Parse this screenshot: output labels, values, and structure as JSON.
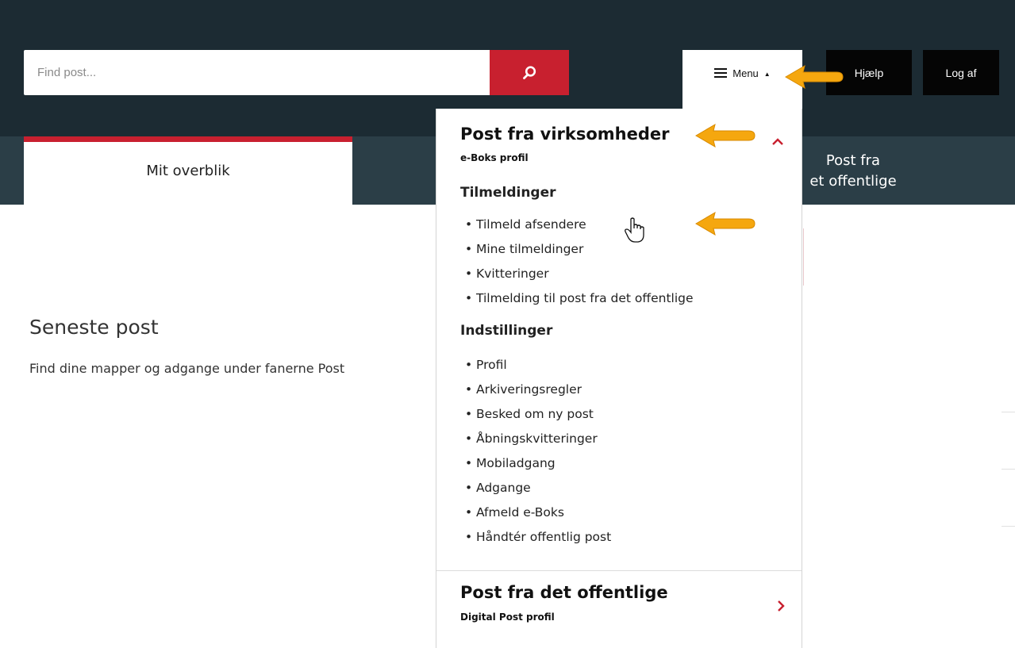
{
  "header": {
    "search": {
      "placeholder": "Find post...",
      "value": ""
    },
    "search_button_icon": "search-icon",
    "menu": {
      "label": "Menu",
      "caret": "▲",
      "icon": "hamburger-icon"
    },
    "help_label": "Hjælp",
    "logout_label": "Log af"
  },
  "tabs": {
    "active_label": "Mit overblik",
    "second_line1": "Post fra",
    "second_line2": "et offentlige"
  },
  "main": {
    "title": "Seneste post",
    "description": "Find dine mapper og adgange under fanerne Post"
  },
  "menu_dropdown": {
    "group1": {
      "title": "Post fra virksomheder",
      "subtitle": "e-Boks profil",
      "sections": [
        {
          "heading": "Tilmeldinger",
          "items": [
            "Tilmeld afsendere",
            "Mine tilmeldinger",
            "Kvitteringer",
            "Tilmelding til post fra det offentlige"
          ]
        },
        {
          "heading": "Indstillinger",
          "items": [
            "Profil",
            "Arkiveringsregler",
            "Besked om ny post",
            "Åbningskvitteringer",
            "Mobiladgang",
            "Adgange",
            "Afmeld e-Boks",
            "Håndtér offentlig post"
          ]
        }
      ]
    },
    "group2": {
      "title": "Post fra det offentlige",
      "subtitle": "Digital Post profil"
    },
    "bullet": "•"
  },
  "colors": {
    "header_bg": "#1c2b33",
    "tabbar_bg": "#2b3e47",
    "accent_red": "#c8202f",
    "annotation_arrow": "#f5a70f"
  }
}
